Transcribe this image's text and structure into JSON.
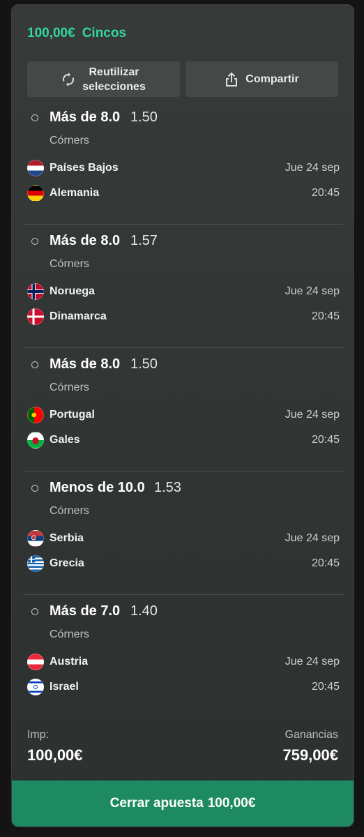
{
  "header": {
    "amount": "100,00€",
    "bet_type": "Cincos"
  },
  "actions": {
    "reuse_line1": "Reutilizar",
    "reuse_line2": "selecciones",
    "share_label": "Compartir"
  },
  "legs": [
    {
      "market": "Más de 8.0",
      "odds": "1.50",
      "type": "Córners",
      "home": "Países Bajos",
      "away": "Alemania",
      "date": "Jue 24 sep",
      "time": "20:45",
      "home_flag": "flag-netherlands-icon",
      "away_flag": "flag-germany-icon"
    },
    {
      "market": "Más de 8.0",
      "odds": "1.57",
      "type": "Córners",
      "home": "Noruega",
      "away": "Dinamarca",
      "date": "Jue 24 sep",
      "time": "20:45",
      "home_flag": "flag-norway-icon",
      "away_flag": "flag-denmark-icon"
    },
    {
      "market": "Más de 8.0",
      "odds": "1.50",
      "type": "Córners",
      "home": "Portugal",
      "away": "Gales",
      "date": "Jue 24 sep",
      "time": "20:45",
      "home_flag": "flag-portugal-icon",
      "away_flag": "flag-wales-icon"
    },
    {
      "market": "Menos de 10.0",
      "odds": "1.53",
      "type": "Córners",
      "home": "Serbia",
      "away": "Grecia",
      "date": "Jue 24 sep",
      "time": "20:45",
      "home_flag": "flag-serbia-icon",
      "away_flag": "flag-greece-icon"
    },
    {
      "market": "Más de 7.0",
      "odds": "1.40",
      "type": "Córners",
      "home": "Austria",
      "away": "Israel",
      "date": "Jue 24 sep",
      "time": "20:45",
      "home_flag": "flag-austria-icon",
      "away_flag": "flag-israel-icon"
    }
  ],
  "summary": {
    "stake_label": "Imp:",
    "stake_value": "100,00€",
    "winnings_label": "Ganancias",
    "winnings_value": "759,00€"
  },
  "close_button": {
    "label": "Cerrar apuesta",
    "amount": "100,00€"
  },
  "colors": {
    "accent": "#33d6a2",
    "close_button": "#1e8a61",
    "card": "#323634"
  }
}
